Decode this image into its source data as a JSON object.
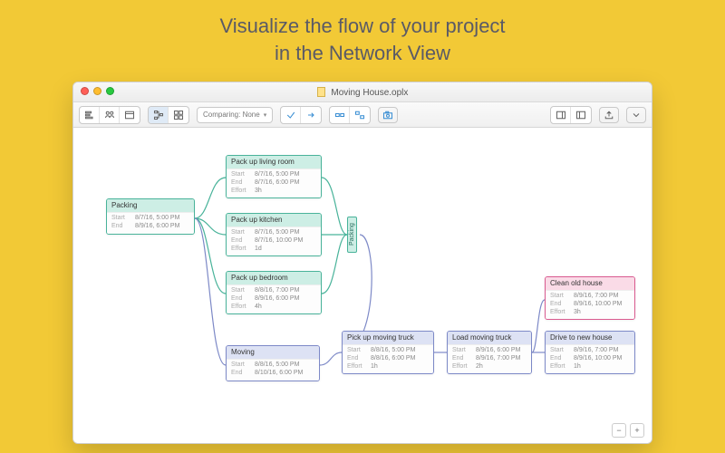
{
  "headline": {
    "line1": "Visualize the flow of your project",
    "line2": "in the Network View"
  },
  "window": {
    "title": "Moving House.oplx"
  },
  "toolbar": {
    "compare_label": "Comparing: None"
  },
  "nodes": {
    "packing": {
      "title": "Packing",
      "start": "8/7/16, 5:00 PM",
      "end": "8/9/16, 6:00 PM"
    },
    "living": {
      "title": "Pack up living room",
      "start": "8/7/16, 5:00 PM",
      "end": "8/7/16, 6:00 PM",
      "effort": "3h"
    },
    "kitchen": {
      "title": "Pack up kitchen",
      "start": "8/7/16, 5:00 PM",
      "end": "8/7/16, 10:00 PM",
      "effort": "1d"
    },
    "bedroom": {
      "title": "Pack up bedroom",
      "start": "8/8/16, 7:00 PM",
      "end": "8/9/16, 6:00 PM",
      "effort": "4h"
    },
    "moving": {
      "title": "Moving",
      "start": "8/8/16, 5:00 PM",
      "end": "8/10/16, 6:00 PM"
    },
    "pickup": {
      "title": "Pick up moving truck",
      "start": "8/8/16, 5:00 PM",
      "end": "8/8/16, 6:00 PM",
      "effort": "1h"
    },
    "load": {
      "title": "Load moving truck",
      "start": "8/9/16, 6:00 PM",
      "end": "8/9/16, 7:00 PM",
      "effort": "2h"
    },
    "drive": {
      "title": "Drive to new house",
      "start": "8/9/16, 7:00 PM",
      "end": "8/9/16, 10:00 PM",
      "effort": "1h"
    },
    "clean": {
      "title": "Clean old house",
      "start": "8/9/16, 7:00 PM",
      "end": "8/9/16, 10:00 PM",
      "effort": "3h"
    },
    "packing_vlabel": "Packing"
  },
  "labels": {
    "start": "Start",
    "end": "End",
    "effort": "Effort"
  },
  "zoom": {
    "out": "−",
    "in": "+"
  }
}
